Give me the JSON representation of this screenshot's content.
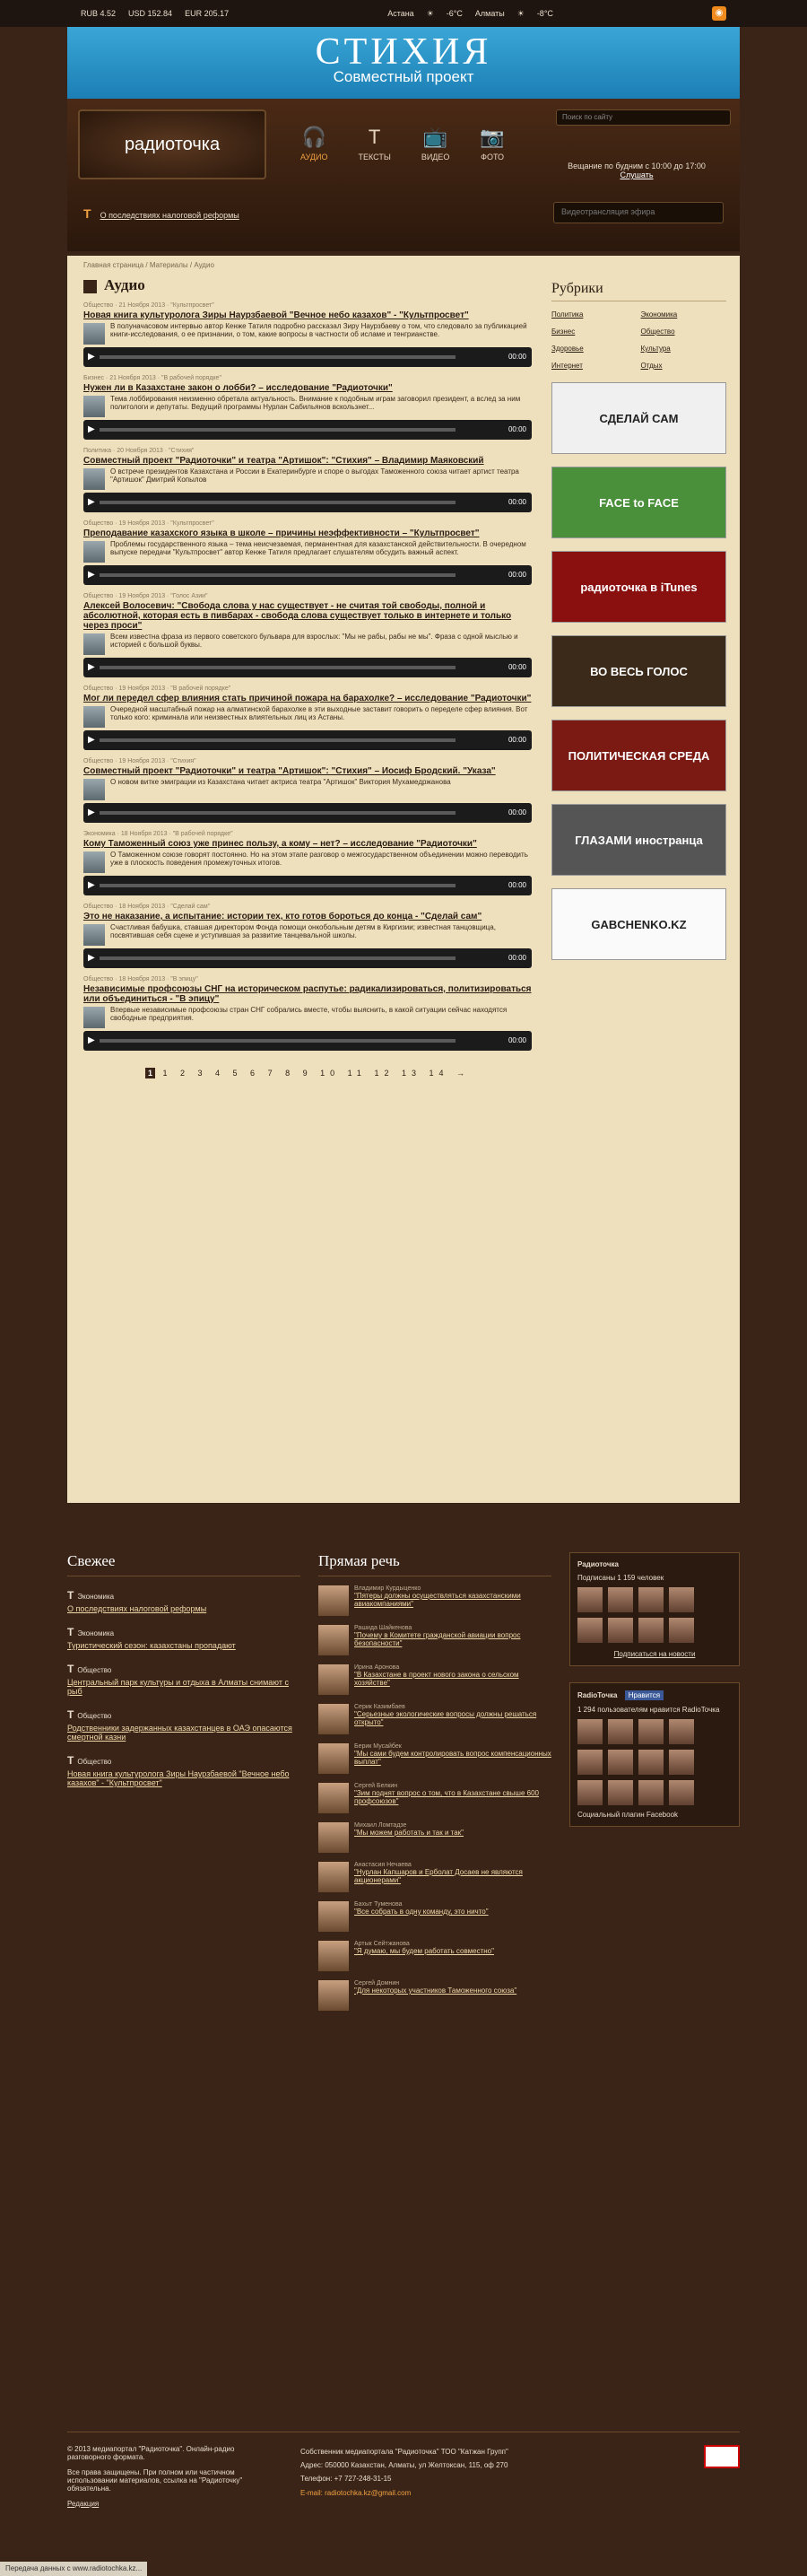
{
  "topbar": {
    "rub": "RUB 4.52",
    "usd": "USD 152.84",
    "eur": "EUR 205.17",
    "city1": "Астана",
    "temp1": "-6°C",
    "city2": "Алматы",
    "temp2": "-8°C"
  },
  "banner": {
    "title": "СТИХИЯ",
    "subtitle": "Совместный проект"
  },
  "header": {
    "logo": "радиоточка",
    "nav": [
      {
        "label": "АУДИО",
        "icon": "headphones-icon"
      },
      {
        "label": "ТЕКСТЫ",
        "icon": "text-icon"
      },
      {
        "label": "ВИДЕО",
        "icon": "tv-icon"
      },
      {
        "label": "ФОТО",
        "icon": "camera-icon"
      }
    ],
    "search_placeholder": "Поиск по сайту",
    "onair": "Вещание по будним с 10:00 до 17:00",
    "listen": "Слушать",
    "tax_link": "О последствиях налоговой реформы",
    "player_label": "Видеотрансляция эфира"
  },
  "main": {
    "breadcrumbs": "Главная страница / Материалы / Аудио",
    "title": "Аудио",
    "time": "00:00",
    "articles": [
      {
        "meta": "Общество · 21 Ноября 2013 · \"Культпросвет\"",
        "title": "Новая книга культуролога Зиры Наурзбаевой \"Вечное небо казахов\" - \"Культпросвет\"",
        "text": "В полуначасовом интервью автор Кенже Татиля подробно рассказал Зиру Наурзбаеву о том, что следовало за публикацией книги-исследования, о ее признании, о том, какие вопросы в частности об исламе и тенгрианстве."
      },
      {
        "meta": "Бизнес · 21 Ноября 2013 · \"В рабочей порядке\"",
        "title": "Нужен ли в Казахстане закон о лобби? – исследование \"Радиоточки\"",
        "text": "Тема лоббирования неизменно обретала актуальность. Внимание к подобным играм заговорил президент, а вслед за ним политологи и депутаты. Ведущий программы Нурлан Сабильянов вскользнет..."
      },
      {
        "meta": "Политика · 20 Ноября 2013 · \"Стихия\"",
        "title": "Совместный проект \"Радиоточки\" и театра \"Артишок\": \"Стихия\" – Владимир Маяковский",
        "text": "О встрече президентов Казахстана и России в Екатеринбурге и споре о выгодах Таможенного союза читает артист театра \"Артишок\" Дмитрий Копылов"
      },
      {
        "meta": "Общество · 19 Ноября 2013 · \"Культпросвет\"",
        "title": "Преподавание казахского языка в школе – причины неэффективности – \"Культпросвет\"",
        "text": "Проблемы государственного языка – тема неисчезаемая, перманентная для казахстанской действительности. В очередном выпуске передачи \"Культпросвет\" автор Кенже Татиля предлагает слушателям обсудить важный аспект."
      },
      {
        "meta": "Общество · 19 Ноября 2013 · \"Голос Азии\"",
        "title": "Алексей Волосевич: \"Свобода слова у нас существует - не считая той свободы, полной и абсолютной, которая есть в пивбарах - свобода слова существует только в интернете и только через проси\"",
        "text": "Всем известна фраза из первого советского бульвара для взрослых: \"Мы не рабы, рабы не мы\". Фраза с одной мыслью и историей с большой буквы."
      },
      {
        "meta": "Общество · 19 Ноября 2013 · \"В рабочей порядке\"",
        "title": "Мог ли передел сфер влияния стать причиной пожара на барахолке? – исследование \"Радиоточки\"",
        "text": "Очередной масштабный пожар на алматинской барахолке в эти выходные заставит говорить о переделе сфер влияния. Вот только кого: криминала или неизвестных влиятельных лиц из Астаны."
      },
      {
        "meta": "Общество · 19 Ноября 2013 · \"Стихия\"",
        "title": "Совместный проект \"Радиоточки\" и театра \"Артишок\": \"Стихия\" – Иосиф Бродский. \"Указа\"",
        "text": "О новом витке эмиграции из Казахстана читает актриса театра \"Артишок\" Виктория Мухамедржанова"
      },
      {
        "meta": "Экономика · 18 Ноября 2013 · \"В рабочей порядке\"",
        "title": "Кому Таможенный союз уже принес пользу, а кому – нет? – исследование \"Радиоточки\"",
        "text": "О Таможенном союзе говорят постоянно. Но на этом этапе разговор о межгосударственном объединении можно переводить уже в плоскость поведения промежуточных итогов."
      },
      {
        "meta": "Общество · 18 Ноября 2013 · \"Сделай сам\"",
        "title": "Это не наказание, а испытание: истории тех, кто готов бороться до конца - \"Сделай сам\"",
        "text": "Счастливая бабушка, ставшая директором Фонда помощи онкобольным детям в Киргизии; известная танцовщица, посвятившая себя сцене и уступившая за развитие танцевальной школы."
      },
      {
        "meta": "Общество · 18 Ноября 2013 · \"В эпицу\"",
        "title": "Независимые профсоюзы СНГ на историческом распутье: радикализироваться, политизироваться или объединиться - \"В эпицу\"",
        "text": "Впервые независимые профсоюзы стран СНГ собрались вместе, чтобы выяснить, в какой ситуации сейчас находятся свободные предприятия."
      }
    ],
    "pages": "1 2 3 4 5 6 7 8 9 10 11 12 13 14 →"
  },
  "side": {
    "title": "Рубрики",
    "rubrics": [
      "Политика",
      "Экономика",
      "Бизнес",
      "Общество",
      "Здоровье",
      "Культура",
      "Интернет",
      "Отдых"
    ],
    "banners": [
      {
        "text": "СДЕЛАЙ САМ",
        "bg": "#f0f0f0",
        "fg": "#222"
      },
      {
        "text": "FACE to FACE",
        "bg": "#4a8f3a",
        "fg": "#fff"
      },
      {
        "text": "радиоточка в iTunes",
        "bg": "#8a1010",
        "fg": "#fff"
      },
      {
        "text": "ВО ВЕСЬ ГОЛОС",
        "bg": "#3b2a1a",
        "fg": "#fff"
      },
      {
        "text": "ПОЛИТИЧЕСКАЯ СРЕДА",
        "bg": "#7a1a12",
        "fg": "#fff"
      },
      {
        "text": "ГЛАЗАМИ иностранца",
        "bg": "#555",
        "fg": "#fff"
      },
      {
        "text": "GABCHENKO.KZ",
        "bg": "#fafafa",
        "fg": "#222"
      }
    ]
  },
  "bottom": {
    "news_title": "Свежее",
    "news": [
      {
        "cat": "Экономика",
        "title": "О последствиях налоговой реформы"
      },
      {
        "cat": "Экономика",
        "title": "Туристический сезон: казахстаны пропадают"
      },
      {
        "cat": "Общество",
        "title": "Центральный парк культуры и отдыха в Алматы снимают с рыб"
      },
      {
        "cat": "Общество",
        "title": "Родственники задержанных казахстанцев в ОАЭ опасаются смертной казни"
      },
      {
        "cat": "Общество",
        "title": "Новая книга культуролога Зиры Наурзбаевой \"Вечное небо казахов\" - \"Культпросвет\""
      }
    ],
    "speech_title": "Прямая речь",
    "speech": [
      {
        "name": "Владимир Курдыценко",
        "title": "\"Пятеры должны осуществляться казахстанскими авиакомпаниями\""
      },
      {
        "name": "Рашида Шайкенова",
        "title": "\"Почему в Комитете гражданской авиации вопрос безопасности\""
      },
      {
        "name": "Ирина Аронова",
        "title": "\"В Казахстане в проект нового закона о сельском хозяйстве\""
      },
      {
        "name": "Серик Казимбаев",
        "title": "\"Серьезные экологические вопросы должны решаться открыто\""
      },
      {
        "name": "Берик Мусайбек",
        "title": "\"Мы сами будем контролировать вопрос компенсационных выплат\""
      },
      {
        "name": "Сергей Белкин",
        "title": "\"Зим поднят вопрос о том, что в Казахстане свыше 600 профсоюзов\""
      },
      {
        "name": "Михаил Ломтадзе",
        "title": "\"Мы можем работать и так и так\""
      },
      {
        "name": "Анастасия Нечаева",
        "title": "\"Нурлан Капшаров и Ерболат Досаев не являются акционерами\""
      },
      {
        "name": "Бахыт Туменова",
        "title": "\"Все собрать в одну команду, это ничто\""
      },
      {
        "name": "Артык Сейтжанова",
        "title": "\"Я думаю, мы будем работать совместно\""
      },
      {
        "name": "Сергей Домнин",
        "title": "\"Для некоторых участников Таможенного союза\""
      }
    ],
    "vk_title": "Радиоточка",
    "vk_subs": "Подписаны 1 159 человек",
    "vk_btn": "Подписаться на новости",
    "fb_title": "RadioToчка",
    "fb_like": "Нравится",
    "fb_count": "1 294 пользователям нравится RadioToчка",
    "fb_foot": "Социальный плагин Facebook"
  },
  "footer": {
    "copy": "© 2013 медиапортал \"Радиоточка\". Онлайн-радио разговорного формата.",
    "rights": "Все права защищены. При полном или частичном использовании материалов, ссылка на \"Радиоточку\" обязательна.",
    "editor": "Редакция",
    "owner": "Собственник медиапортала \"Радиоточка\" ТОО \"Катжан Групп\"",
    "address": "Адрес: 050000 Казахстан, Алматы, ул Желтоксан, 115, оф 270",
    "phone": "Телефон: +7 727-248-31-15",
    "email": "E-mail: radiotochka.kz@gmail.com"
  },
  "status": "Передача данных с www.radiotochka.kz..."
}
